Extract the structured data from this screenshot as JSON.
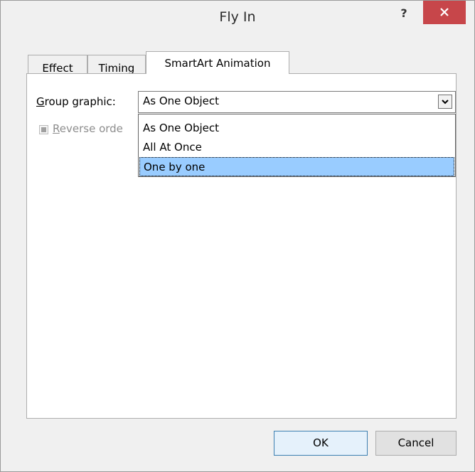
{
  "window": {
    "title": "Fly In",
    "help_label": "?"
  },
  "tabs": [
    {
      "label": "Effect"
    },
    {
      "label": "Timing"
    },
    {
      "label": "SmartArt Animation"
    }
  ],
  "group_graphic": {
    "label_first": "G",
    "label_rest": "roup graphic:",
    "value": "As One Object",
    "options": [
      "As One Object",
      "All At Once",
      "One by one"
    ],
    "highlighted": "One by one"
  },
  "reverse_order": {
    "label_first": "R",
    "label_rest": "everse orde",
    "checked": false,
    "enabled": false
  },
  "buttons": {
    "ok": "OK",
    "cancel": "Cancel"
  },
  "colors": {
    "close_button": "#c7464a",
    "highlight": "#99ccff"
  }
}
